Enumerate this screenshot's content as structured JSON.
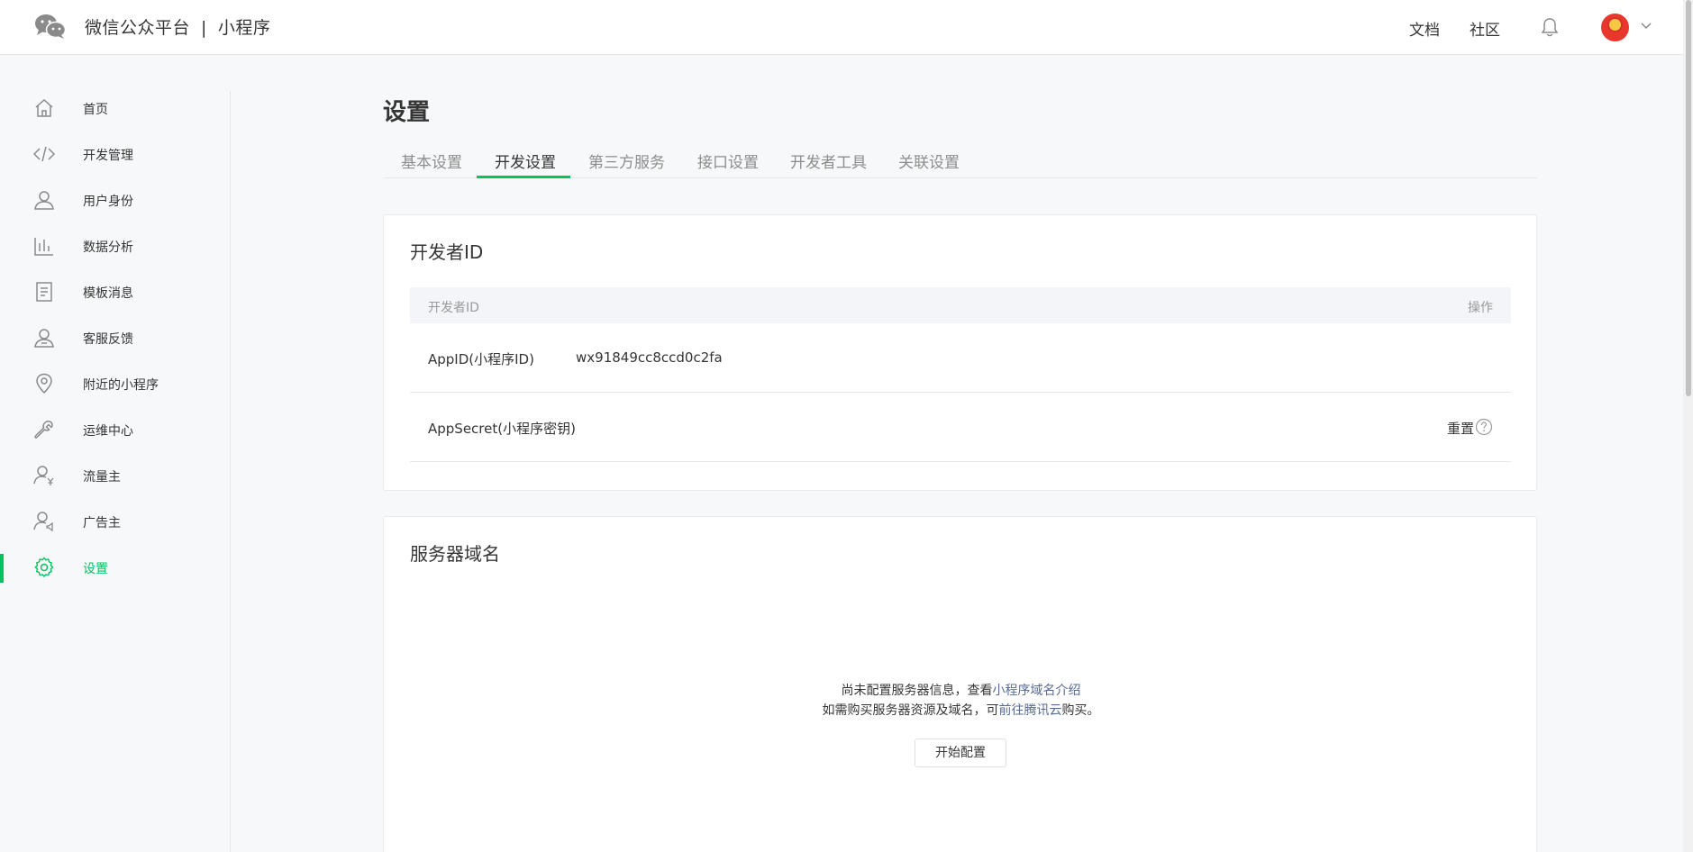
{
  "header": {
    "brand_name": "微信公众平台",
    "brand_separator": "|",
    "brand_product": "小程序",
    "links": [
      "文档",
      "社区"
    ],
    "icons": [
      "wechat-logo-icon",
      "bell-icon",
      "avatar",
      "chevron-down-icon"
    ]
  },
  "sidebar": {
    "items": [
      {
        "label": "首页",
        "icon": "home-icon"
      },
      {
        "label": "开发管理",
        "icon": "code-icon"
      },
      {
        "label": "用户身份",
        "icon": "user-icon"
      },
      {
        "label": "数据分析",
        "icon": "bar-chart-icon"
      },
      {
        "label": "模板消息",
        "icon": "document-icon"
      },
      {
        "label": "客服反馈",
        "icon": "customer-service-icon"
      },
      {
        "label": "附近的小程序",
        "icon": "location-pin-icon"
      },
      {
        "label": "运维中心",
        "icon": "wrench-icon"
      },
      {
        "label": "流量主",
        "icon": "user-yen-icon"
      },
      {
        "label": "广告主",
        "icon": "user-speaker-icon"
      },
      {
        "label": "设置",
        "icon": "gear-icon",
        "active": true
      }
    ]
  },
  "main": {
    "title": "设置",
    "tabs": [
      "基本设置",
      "开发设置",
      "第三方服务",
      "接口设置",
      "开发者工具",
      "关联设置"
    ],
    "active_tab": "开发设置"
  },
  "developer_id": {
    "title": "开发者ID",
    "columns": [
      "开发者ID",
      "操作"
    ],
    "rows": [
      {
        "label": "AppID(小程序ID)",
        "value": "wx91849cc8ccd0c2fa",
        "action": ""
      },
      {
        "label": "AppSecret(小程序密钥)",
        "value": "",
        "action": "重置"
      }
    ]
  },
  "server_domain": {
    "title": "服务器域名",
    "line1_prefix": "尚未配置服务器信息，查看",
    "line1_link": "小程序域名介绍",
    "line2_prefix": "如需购买服务器资源及域名，可",
    "line2_link": "前往腾讯云",
    "line2_suffix": "购买。",
    "button": "开始配置"
  },
  "colors": {
    "accent": "#07c160",
    "link": "#576b95",
    "text": "#353535",
    "muted": "#9a9a9a",
    "background": "#f6f8f9"
  }
}
